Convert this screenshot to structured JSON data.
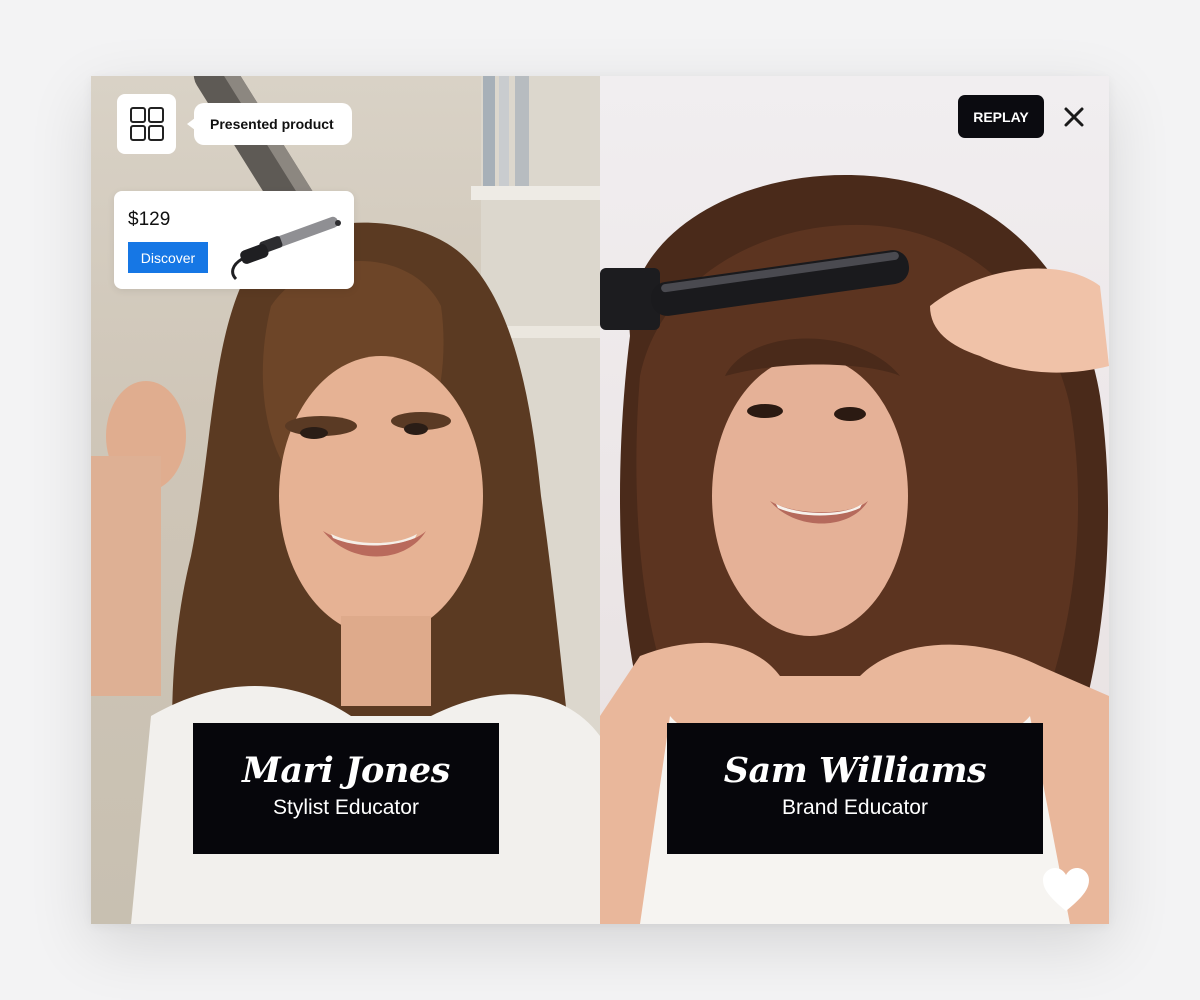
{
  "left_panel": {
    "tooltip_label": "Presented product",
    "product": {
      "price": "$129",
      "cta_label": "Discover"
    },
    "presenter": {
      "name": "Mari Jones",
      "role": "Stylist Educator"
    }
  },
  "right_panel": {
    "replay_label": "REPLAY",
    "presenter": {
      "name": "Sam Williams",
      "role": "Brand Educator"
    }
  },
  "icons": {
    "grid": "grid-icon",
    "close": "close-icon",
    "heart": "heart-icon",
    "product": "curling-iron-icon"
  },
  "colors": {
    "accent": "#1677e5",
    "name_card_bg": "#06060b",
    "replay_bg": "#0b0b10"
  }
}
